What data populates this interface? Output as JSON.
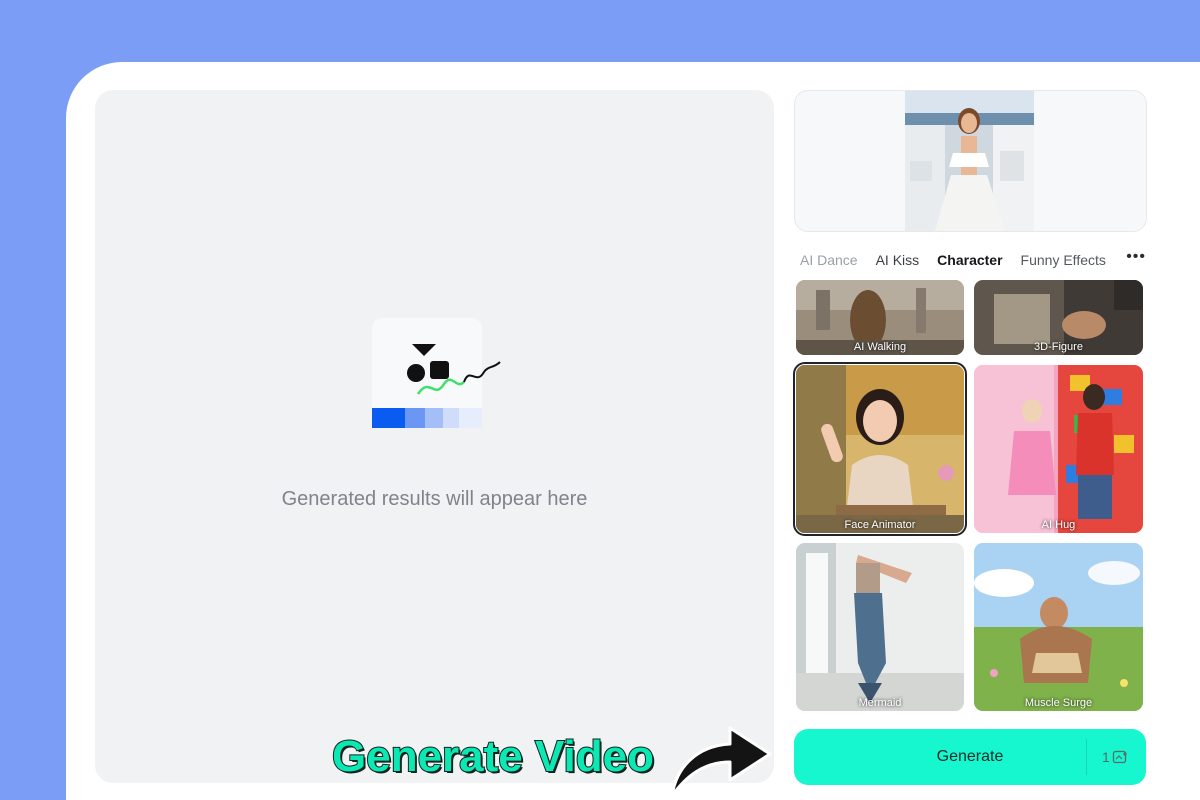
{
  "preview": {
    "placeholder_text": "Generated results will appear here"
  },
  "tabs": [
    {
      "label": "AI Dance"
    },
    {
      "label": "AI Kiss"
    },
    {
      "label": "Character"
    },
    {
      "label": "Funny Effects"
    }
  ],
  "more_label": "•••",
  "templates": [
    {
      "label": "AI Walking"
    },
    {
      "label": "3D-Figure"
    },
    {
      "label": "Face Animator"
    },
    {
      "label": "AI Hug"
    },
    {
      "label": "Mermaid"
    },
    {
      "label": "Muscle Surge"
    }
  ],
  "generate": {
    "label": "Generate",
    "credits": "1"
  },
  "overlay": {
    "text": "Generate Video"
  },
  "colors": {
    "background": "#7c9df5",
    "accent": "#16f6cf",
    "overlay_text": "#0ce8b4"
  }
}
